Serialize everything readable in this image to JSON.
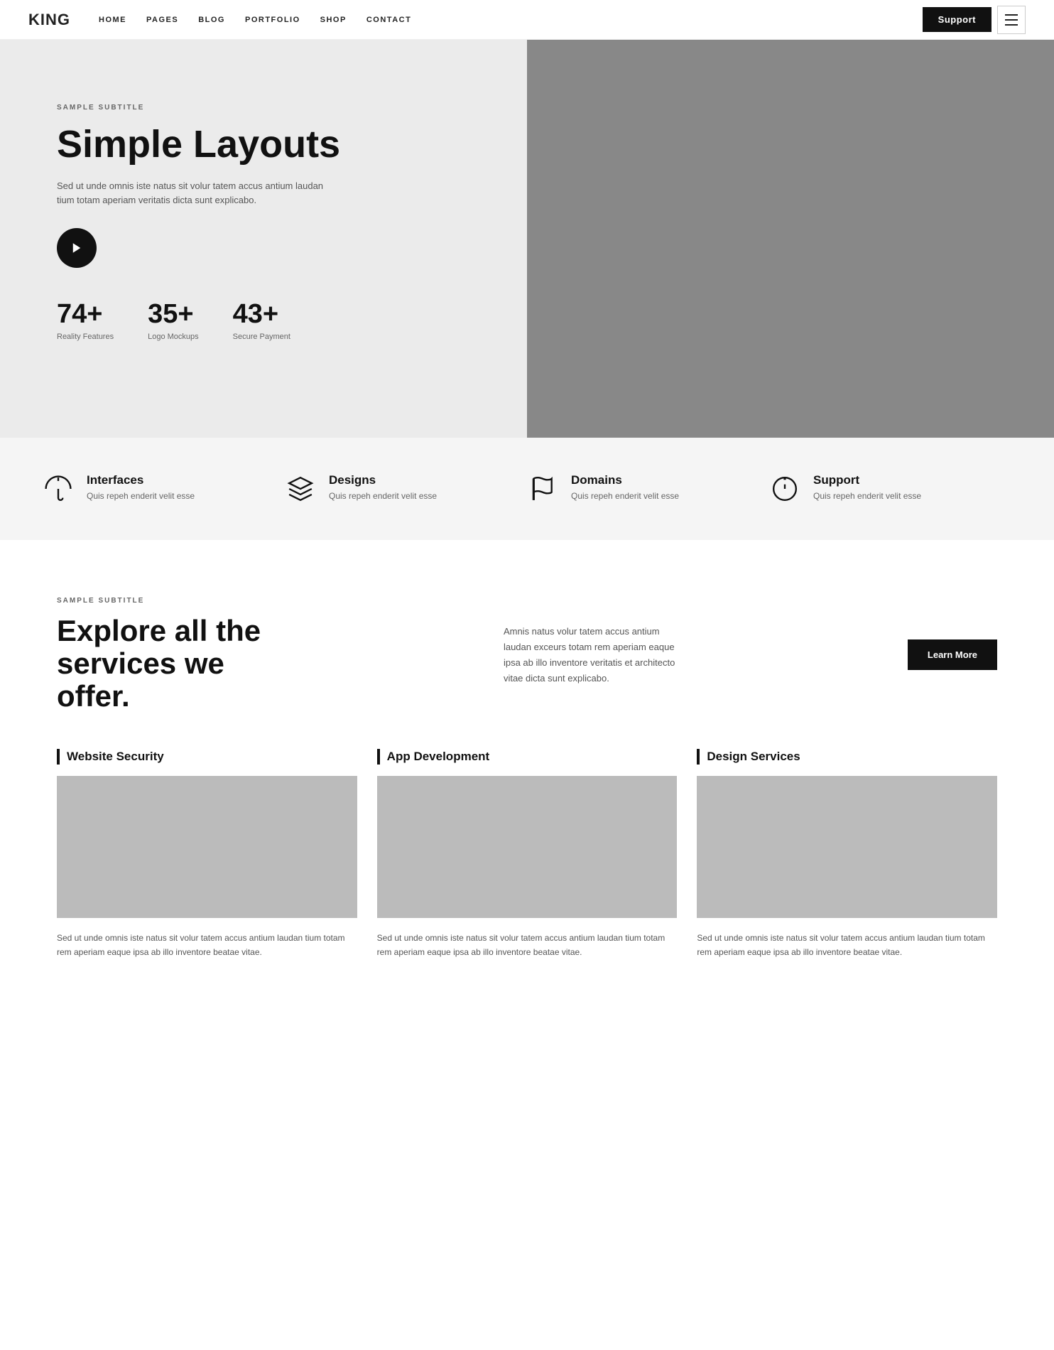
{
  "nav": {
    "logo": "KING",
    "links": [
      {
        "label": "HOME"
      },
      {
        "label": "PAGES"
      },
      {
        "label": "BLOG"
      },
      {
        "label": "PORTFOLIO"
      },
      {
        "label": "SHOP"
      },
      {
        "label": "CONTACT"
      }
    ],
    "support_label": "Support"
  },
  "hero": {
    "subtitle": "SAMPLE SUBTITLE",
    "title": "Simple Layouts",
    "description": "Sed ut unde omnis iste natus sit volur tatem accus antium laudan tium totam aperiam veritatis dicta sunt explicabo.",
    "stats": [
      {
        "number": "74+",
        "label": "Reality Features"
      },
      {
        "number": "35+",
        "label": "Logo Mockups"
      },
      {
        "number": "43+",
        "label": "Secure Payment"
      }
    ]
  },
  "features": [
    {
      "icon": "umbrella",
      "title": "Interfaces",
      "desc": "Quis repeh enderit velit esse"
    },
    {
      "icon": "layers",
      "title": "Designs",
      "desc": "Quis repeh enderit velit esse"
    },
    {
      "icon": "flag",
      "title": "Domains",
      "desc": "Quis repeh enderit velit esse"
    },
    {
      "icon": "clock-alert",
      "title": "Support",
      "desc": "Quis repeh enderit velit esse"
    }
  ],
  "services": {
    "subtitle": "SAMPLE SUBTITLE",
    "title": "Explore all the services we offer.",
    "description": "Amnis natus volur tatem accus antium laudan exceurs totam rem aperiam eaque ipsa ab illo inventore veritatis et architecto vitae dicta sunt explicabo.",
    "learn_more_label": "Learn More",
    "cards": [
      {
        "title": "Website Security",
        "desc": "Sed ut unde omnis iste natus sit volur tatem accus antium laudan tium totam rem aperiam eaque ipsa ab illo inventore beatae vitae."
      },
      {
        "title": "App Development",
        "desc": "Sed ut unde omnis iste natus sit volur tatem accus antium laudan tium totam rem aperiam eaque ipsa ab illo inventore beatae vitae."
      },
      {
        "title": "Design Services",
        "desc": "Sed ut unde omnis iste natus sit volur tatem accus antium laudan tium totam rem aperiam eaque ipsa ab illo inventore beatae vitae."
      }
    ]
  }
}
